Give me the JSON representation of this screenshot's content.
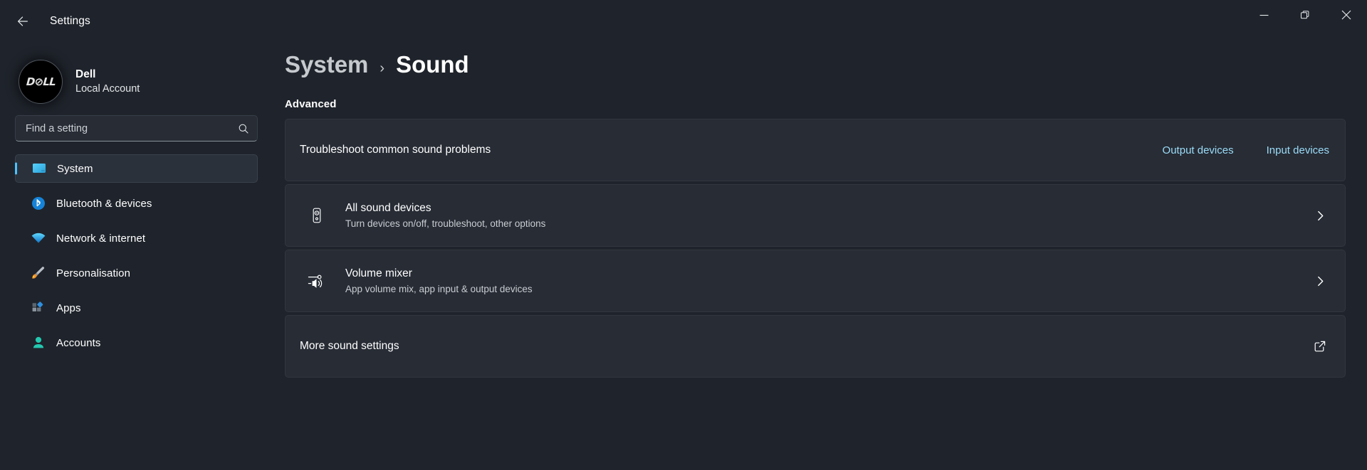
{
  "titlebar": {
    "back_icon": "arrow-left-icon",
    "title": "Settings",
    "minimize_icon": "minimize-icon",
    "restore_icon": "restore-icon",
    "close_icon": "close-icon"
  },
  "sidebar": {
    "account": {
      "avatar_text": "D⊘LL",
      "name": "Dell",
      "subtitle": "Local Account"
    },
    "search": {
      "placeholder": "Find a setting",
      "value": "",
      "icon": "search-icon"
    },
    "items": [
      {
        "label": "System",
        "icon": "monitor-icon",
        "selected": true
      },
      {
        "label": "Bluetooth & devices",
        "icon": "bluetooth-icon",
        "selected": false
      },
      {
        "label": "Network & internet",
        "icon": "wifi-icon",
        "selected": false
      },
      {
        "label": "Personalisation",
        "icon": "paintbrush-icon",
        "selected": false
      },
      {
        "label": "Apps",
        "icon": "apps-icon",
        "selected": false
      },
      {
        "label": "Accounts",
        "icon": "person-icon",
        "selected": false
      }
    ]
  },
  "main": {
    "breadcrumb": {
      "parent": "System",
      "separator": "›",
      "current": "Sound"
    },
    "section": "Advanced",
    "cards": [
      {
        "title": "Troubleshoot common sound problems",
        "subtitle": "",
        "icon": "",
        "links": [
          {
            "label": "Output devices"
          },
          {
            "label": "Input devices"
          }
        ],
        "trailing": "links"
      },
      {
        "title": "All sound devices",
        "subtitle": "Turn devices on/off, troubleshoot, other options",
        "icon": "speaker-icon",
        "links": [],
        "trailing": "chevron-right-icon"
      },
      {
        "title": "Volume mixer",
        "subtitle": "App volume mix, app input & output devices",
        "icon": "volume-mixer-icon",
        "links": [],
        "trailing": "chevron-right-icon"
      },
      {
        "title": "More sound settings",
        "subtitle": "",
        "icon": "",
        "links": [],
        "trailing": "external-link-icon"
      }
    ]
  },
  "colors": {
    "accent": "#4cc2ff",
    "link": "#9bdcf8",
    "background": "#1f242c",
    "card": "#272c35"
  }
}
